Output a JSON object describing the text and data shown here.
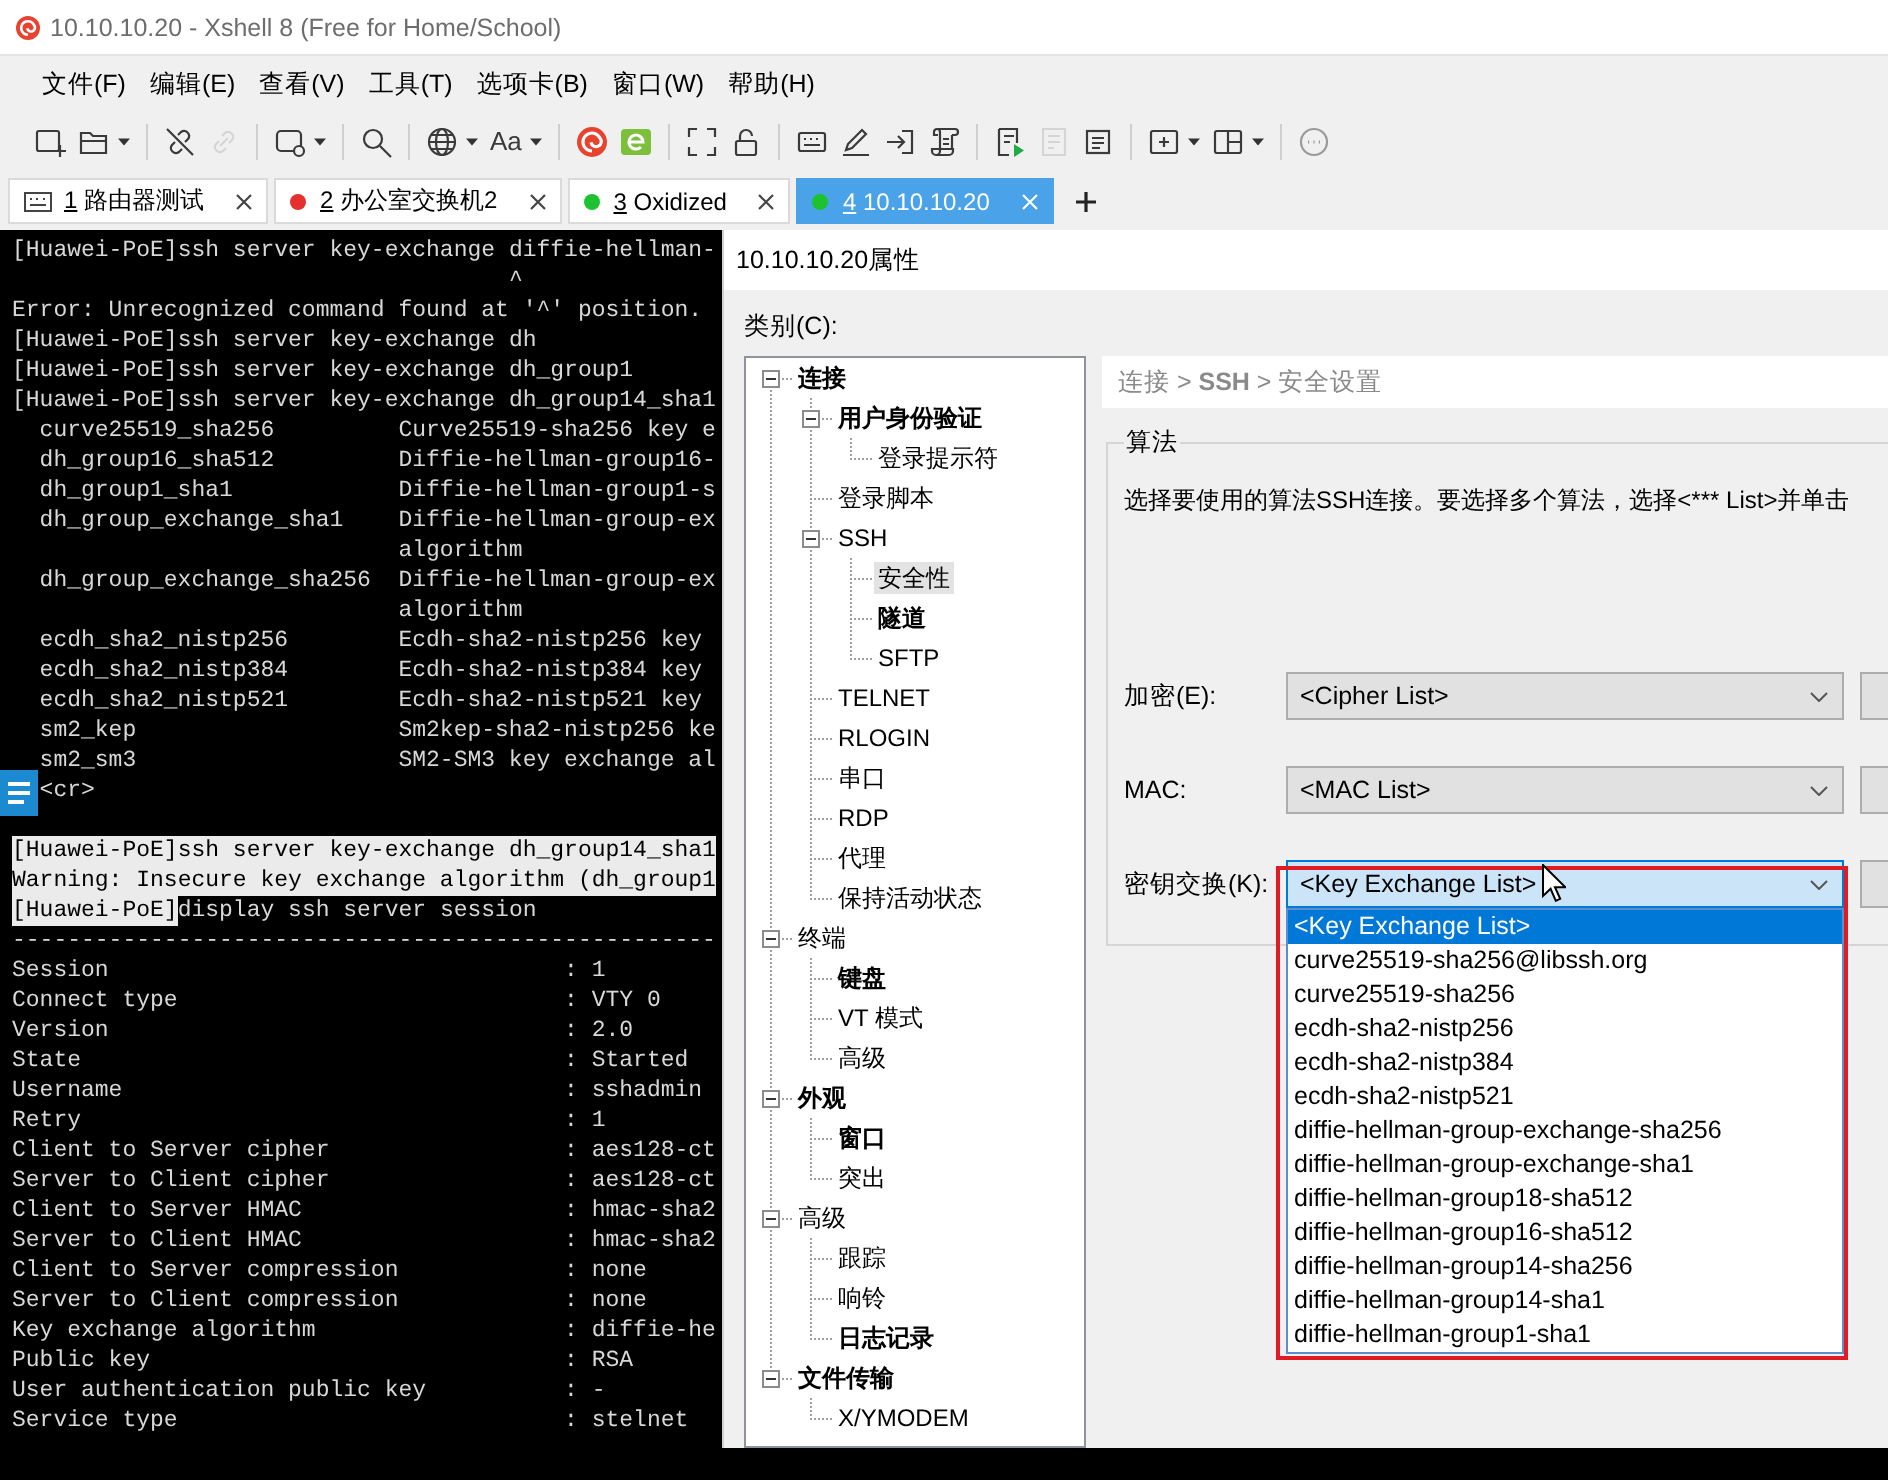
{
  "window": {
    "title": "10.10.10.20 - Xshell 8 (Free for Home/School)"
  },
  "menu": [
    "文件(F)",
    "编辑(E)",
    "查看(V)",
    "工具(T)",
    "选项卡(B)",
    "窗口(W)",
    "帮助(H)"
  ],
  "toolbar": [
    [
      {
        "kind": "new",
        "disabled": false,
        "menu": false
      },
      {
        "kind": "open",
        "disabled": false,
        "menu": true
      }
    ],
    [
      {
        "kind": "unlink",
        "disabled": false,
        "menu": false
      },
      {
        "kind": "link",
        "disabled": true,
        "menu": false
      }
    ],
    [
      {
        "kind": "window",
        "disabled": false,
        "menu": true
      }
    ],
    [
      {
        "kind": "find",
        "disabled": false,
        "menu": false
      }
    ],
    [
      {
        "kind": "globe",
        "disabled": false,
        "menu": true
      },
      {
        "kind": "font",
        "label": "Aa",
        "disabled": false,
        "menu": true
      }
    ],
    [
      {
        "kind": "xshell",
        "disabled": false,
        "menu": false
      },
      {
        "kind": "xftp",
        "disabled": false,
        "menu": false
      }
    ],
    [
      {
        "kind": "fullscreen",
        "disabled": false,
        "menu": false
      },
      {
        "kind": "lock",
        "disabled": false,
        "menu": false
      }
    ],
    [
      {
        "kind": "keyboard",
        "disabled": false,
        "menu": false
      },
      {
        "kind": "compose",
        "disabled": false,
        "menu": false
      },
      {
        "kind": "enter",
        "disabled": false,
        "menu": false
      },
      {
        "kind": "script",
        "disabled": false,
        "menu": false
      }
    ],
    [
      {
        "kind": "run",
        "disabled": false,
        "menu": false
      },
      {
        "kind": "stop",
        "disabled": true,
        "menu": false
      },
      {
        "kind": "notes",
        "disabled": false,
        "menu": false
      }
    ],
    [
      {
        "kind": "add",
        "disabled": false,
        "menu": true
      },
      {
        "kind": "layout",
        "disabled": false,
        "menu": true
      }
    ],
    [
      {
        "kind": "chat",
        "disabled": false,
        "menu": false
      }
    ]
  ],
  "tabs": [
    {
      "kind": "device",
      "number": "1",
      "label": "路由器测试",
      "selected": false
    },
    {
      "kind": "dot",
      "color": "#e5302d",
      "number": "2",
      "label": "办公室交换机2",
      "selected": false
    },
    {
      "kind": "dot",
      "color": "#1cc32e",
      "number": "3",
      "label": "Oxidized",
      "selected": false
    },
    {
      "kind": "dot",
      "color": "#1cc32e",
      "number": "4",
      "label": "10.10.10.20",
      "selected": true
    }
  ],
  "terminal": {
    "outputs": [
      {
        "lines": [
          {
            "kind": "text",
            "text": "[Huawei-PoE]ssh server key-exchange diffie-hellman-",
            "highlighted": false
          },
          {
            "kind": "text",
            "text": "                                    ^",
            "highlighted": false
          },
          {
            "kind": "text",
            "text": "Error: Unrecognized command found at '^' position.",
            "highlighted": false
          },
          {
            "kind": "text",
            "text": "[Huawei-PoE]ssh server key-exchange dh",
            "highlighted": false
          },
          {
            "kind": "text",
            "text": "[Huawei-PoE]ssh server key-exchange dh_group1",
            "highlighted": false
          },
          {
            "kind": "text",
            "text": "[Huawei-PoE]ssh server key-exchange dh_group14_sha1",
            "highlighted": false
          },
          {
            "kind": "option",
            "name": "curve25519_sha256",
            "description": "Curve25519-sha256 key e",
            "highlighted": false
          },
          {
            "kind": "option",
            "name": "dh_group16_sha512",
            "description": "Diffie-hellman-group16-",
            "highlighted": false
          },
          {
            "kind": "option",
            "name": "dh_group1_sha1",
            "description": "Diffie-hellman-group1-s",
            "highlighted": false
          },
          {
            "kind": "option",
            "name": "dh_group_exchange_sha1",
            "description": "Diffie-hellman-group-ex",
            "highlighted": false
          },
          {
            "kind": "option",
            "description": "algorithm",
            "highlighted": false
          },
          {
            "kind": "option",
            "name": "dh_group_exchange_sha256",
            "description": "Diffie-hellman-group-ex",
            "highlighted": false
          },
          {
            "kind": "option",
            "description": "algorithm",
            "highlighted": false
          },
          {
            "kind": "option",
            "name": "ecdh_sha2_nistp256",
            "description": "Ecdh-sha2-nistp256 key",
            "highlighted": false
          },
          {
            "kind": "option",
            "name": "ecdh_sha2_nistp384",
            "description": "Ecdh-sha2-nistp384 key",
            "highlighted": false
          },
          {
            "kind": "option",
            "name": "ecdh_sha2_nistp521",
            "description": "Ecdh-sha2-nistp521 key",
            "highlighted": false
          },
          {
            "kind": "option",
            "name": "sm2_kep",
            "description": "Sm2kep-sha2-nistp256 ke",
            "highlighted": false
          },
          {
            "kind": "option",
            "name": "sm2_sm3",
            "description": "SM2-SM3 key exchange al",
            "highlighted": false
          },
          {
            "kind": "option",
            "name": "<cr>",
            "highlighted": false
          }
        ]
      },
      {
        "lines": [
          {
            "kind": "text",
            "text": "[Huawei-PoE]ssh server key-exchange dh_group14_sha1",
            "highlighted": true
          },
          {
            "kind": "text",
            "text": "Warning: Insecure key exchange algorithm (dh_group1",
            "highlighted": true
          },
          {
            "kind": "split",
            "parts": [
              {
                "text": "[Huawei-PoE]",
                "highlighted": true
              },
              {
                "text": "display ssh server session",
                "highlighted": false
              }
            ]
          },
          {
            "kind": "text",
            "text": "---------------------------------------------------",
            "highlighted": false
          },
          {
            "kind": "field",
            "label": "Session",
            "value": ": 1",
            "highlighted": false
          },
          {
            "kind": "field",
            "label": "Connect type",
            "value": ": VTY 0",
            "highlighted": false
          },
          {
            "kind": "field",
            "label": "Version",
            "value": ": 2.0",
            "highlighted": false
          },
          {
            "kind": "field",
            "label": "State",
            "value": ": Started",
            "highlighted": false
          },
          {
            "kind": "field",
            "label": "Username",
            "value": ": sshadmin",
            "highlighted": false
          },
          {
            "kind": "field",
            "label": "Retry",
            "value": ": 1",
            "highlighted": false
          },
          {
            "kind": "field",
            "label": "Client to Server cipher",
            "value": ": aes128-ct",
            "highlighted": false
          },
          {
            "kind": "field",
            "label": "Server to Client cipher",
            "value": ": aes128-ct",
            "highlighted": false
          },
          {
            "kind": "field",
            "label": "Client to Server HMAC",
            "value": ": hmac-sha2",
            "highlighted": false
          },
          {
            "kind": "field",
            "label": "Server to Client HMAC",
            "value": ": hmac-sha2",
            "highlighted": false
          },
          {
            "kind": "field",
            "label": "Client to Server compression",
            "value": ": none",
            "highlighted": false
          },
          {
            "kind": "field",
            "label": "Server to Client compression",
            "value": ": none",
            "highlighted": false
          },
          {
            "kind": "field",
            "label": "Key exchange algorithm",
            "value": ": diffie-he",
            "highlighted": false
          },
          {
            "kind": "field",
            "label": "Public key",
            "value": ": RSA",
            "highlighted": false
          },
          {
            "kind": "field",
            "label": "User authentication public key",
            "value": ": -",
            "highlighted": false
          },
          {
            "kind": "field",
            "label": "Service type",
            "value": ": stelnet",
            "highlighted": false
          }
        ]
      }
    ]
  },
  "dialog": {
    "title": "10.10.10.20属性",
    "category_label": "类别(C):",
    "categories": [
      {
        "label": "连接",
        "bold": true,
        "selected": false,
        "expanded": true,
        "children": [
          {
            "label": "用户身份验证",
            "bold": true,
            "selected": false,
            "expanded": true,
            "children": [
              {
                "label": "登录提示符",
                "bold": false,
                "selected": false
              }
            ]
          },
          {
            "label": "登录脚本",
            "bold": false,
            "selected": false
          },
          {
            "label": "SSH",
            "bold": false,
            "selected": false,
            "expanded": true,
            "children": [
              {
                "label": "安全性",
                "bold": false,
                "selected": true
              },
              {
                "label": "隧道",
                "bold": true,
                "selected": false
              },
              {
                "label": "SFTP",
                "bold": false,
                "selected": false
              }
            ]
          },
          {
            "label": "TELNET",
            "bold": false,
            "selected": false
          },
          {
            "label": "RLOGIN",
            "bold": false,
            "selected": false
          },
          {
            "label": "串口",
            "bold": false,
            "selected": false
          },
          {
            "label": "RDP",
            "bold": false,
            "selected": false
          },
          {
            "label": "代理",
            "bold": false,
            "selected": false
          },
          {
            "label": "保持活动状态",
            "bold": false,
            "selected": false
          }
        ]
      },
      {
        "label": "终端",
        "bold": false,
        "selected": false,
        "expanded": true,
        "children": [
          {
            "label": "键盘",
            "bold": true,
            "selected": false
          },
          {
            "label": "VT 模式",
            "bold": false,
            "selected": false
          },
          {
            "label": "高级",
            "bold": false,
            "selected": false
          }
        ]
      },
      {
        "label": "外观",
        "bold": true,
        "selected": false,
        "expanded": true,
        "children": [
          {
            "label": "窗口",
            "bold": true,
            "selected": false
          },
          {
            "label": "突出",
            "bold": false,
            "selected": false
          }
        ]
      },
      {
        "label": "高级",
        "bold": false,
        "selected": false,
        "expanded": true,
        "children": [
          {
            "label": "跟踪",
            "bold": false,
            "selected": false
          },
          {
            "label": "响铃",
            "bold": false,
            "selected": false
          },
          {
            "label": "日志记录",
            "bold": true,
            "selected": false
          }
        ]
      },
      {
        "label": "文件传输",
        "bold": true,
        "selected": false,
        "expanded": true,
        "children": [
          {
            "label": "X/YMODEM",
            "bold": false,
            "selected": false
          }
        ]
      }
    ],
    "breadcrumb": "连接 > **SSH** > 安全设置",
    "group": {
      "title": "算法",
      "description": "选择要使用的算法SSH连接。要选择多个算法，选择<*** List>并单击",
      "fields": [
        {
          "label": "加密(E):",
          "value": "<Cipher List>",
          "focused": false,
          "expanded": false,
          "annotated": false
        },
        {
          "label": "MAC:",
          "value": "<MAC List>",
          "focused": false,
          "expanded": false,
          "annotated": false
        },
        {
          "label": "密钥交换(K):",
          "value": "<Key Exchange List>",
          "focused": true,
          "expanded": true,
          "annotated": true,
          "options": [
            {
              "text": "<Key Exchange List>",
              "selected": true
            },
            {
              "text": "curve25519-sha256@libssh.org",
              "selected": false
            },
            {
              "text": "curve25519-sha256",
              "selected": false
            },
            {
              "text": "ecdh-sha2-nistp256",
              "selected": false
            },
            {
              "text": "ecdh-sha2-nistp384",
              "selected": false
            },
            {
              "text": "ecdh-sha2-nistp521",
              "selected": false
            },
            {
              "text": "diffie-hellman-group-exchange-sha256",
              "selected": false
            },
            {
              "text": "diffie-hellman-group-exchange-sha1",
              "selected": false
            },
            {
              "text": "diffie-hellman-group18-sha512",
              "selected": false
            },
            {
              "text": "diffie-hellman-group16-sha512",
              "selected": false
            },
            {
              "text": "diffie-hellman-group14-sha256",
              "selected": false
            },
            {
              "text": "diffie-hellman-group14-sha1",
              "selected": false
            },
            {
              "text": "diffie-hellman-group1-sha1",
              "selected": false
            }
          ]
        }
      ]
    }
  }
}
